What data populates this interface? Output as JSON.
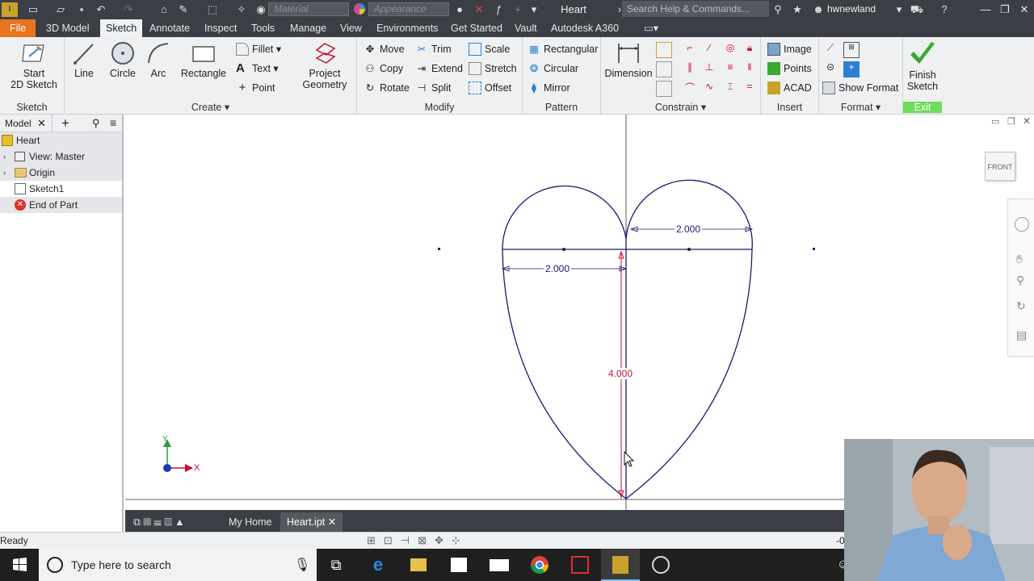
{
  "titlebar": {
    "material_placeholder": "Material",
    "appearance_placeholder": "Appearance",
    "document_title": "Heart",
    "help_search_placeholder": "Search Help & Commands...",
    "user_name": "hwnewland"
  },
  "menu": {
    "tabs": [
      "File",
      "3D Model",
      "Sketch",
      "Annotate",
      "Inspect",
      "Tools",
      "Manage",
      "View",
      "Environments",
      "Get Started",
      "Vault",
      "Autodesk A360"
    ],
    "active_tab": "Sketch"
  },
  "ribbon": {
    "sketch_panel": {
      "label": "Sketch",
      "start_sketch_line1": "Start",
      "start_sketch_line2": "2D Sketch"
    },
    "create_panel": {
      "label": "Create",
      "line": "Line",
      "circle": "Circle",
      "arc": "Arc",
      "rectangle": "Rectangle",
      "fillet": "Fillet",
      "text": "Text",
      "point": "Point",
      "project_geometry_line1": "Project",
      "project_geometry_line2": "Geometry"
    },
    "modify_panel": {
      "label": "Modify",
      "move": "Move",
      "trim": "Trim",
      "scale": "Scale",
      "copy": "Copy",
      "extend": "Extend",
      "stretch": "Stretch",
      "rotate": "Rotate",
      "split": "Split",
      "offset": "Offset"
    },
    "pattern_panel": {
      "label": "Pattern",
      "rectangular": "Rectangular",
      "circular": "Circular",
      "mirror": "Mirror"
    },
    "constrain_panel": {
      "label": "Constrain",
      "dimension": "Dimension"
    },
    "insert_panel": {
      "label": "Insert",
      "image": "Image",
      "points": "Points",
      "acad": "ACAD"
    },
    "format_panel": {
      "label": "Format",
      "show_format": "Show Format"
    },
    "exit_panel": {
      "label": "Exit",
      "finish_line1": "Finish",
      "finish_line2": "Sketch"
    }
  },
  "browser": {
    "tab_label": "Model",
    "tree": [
      {
        "label": "Heart"
      },
      {
        "label": "View: Master"
      },
      {
        "label": "Origin"
      },
      {
        "label": "Sketch1"
      },
      {
        "label": "End of Part"
      }
    ]
  },
  "canvas": {
    "viewcube_label": "FRONT",
    "dim_top_right": "2.000",
    "dim_left": "2.000",
    "dim_height": "4.000",
    "axis_x": "X",
    "axis_y": "Y"
  },
  "doctabs": {
    "home": "My Home",
    "file": "Heart.ipt"
  },
  "status": {
    "text": "Ready",
    "coord": "-0"
  },
  "taskbar": {
    "search_placeholder": "Type here to search"
  },
  "colors": {
    "accent_orange": "#e8741e",
    "sketch_blue": "#1a1a6e",
    "dim_red": "#c8102e",
    "finish_green": "#3aa832"
  }
}
